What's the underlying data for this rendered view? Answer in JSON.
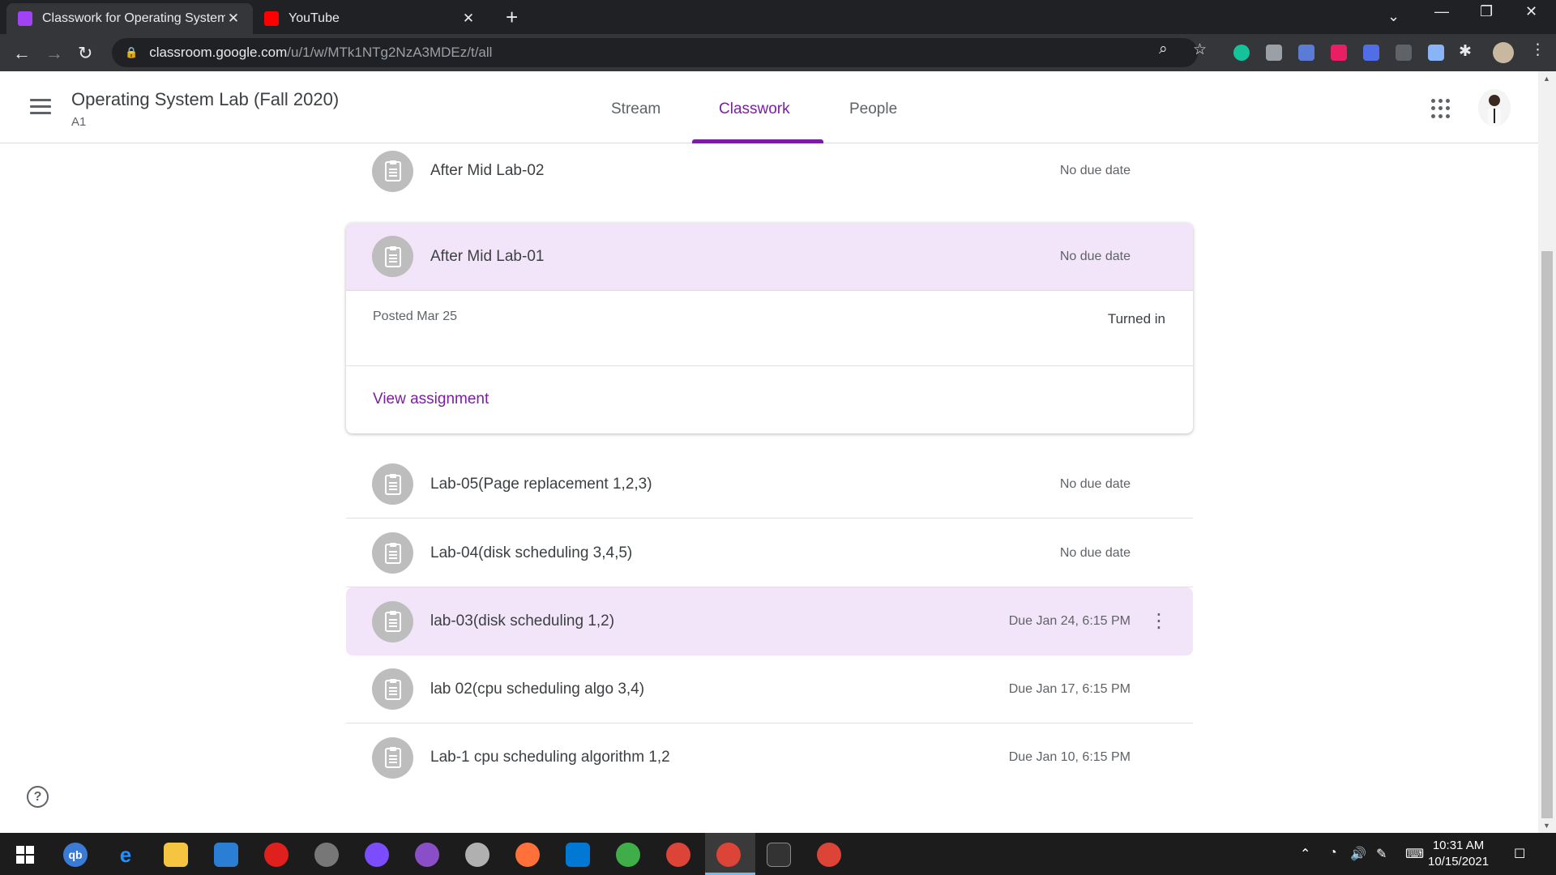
{
  "browser": {
    "tabs": [
      {
        "title": "Classwork for Operating System L",
        "active": true,
        "favicon_color": "#a142f4"
      },
      {
        "title": "YouTube",
        "active": false,
        "favicon_color": "#ff0000"
      }
    ],
    "url": {
      "host": "classroom.google.com",
      "path": "/u/1/w/MTk1NTg2NzA3MDEz/t/all"
    }
  },
  "header": {
    "course_title": "Operating System Lab (Fall 2020)",
    "course_section": "A1",
    "tabs": [
      {
        "label": "Stream",
        "active": false
      },
      {
        "label": "Classwork",
        "active": true
      },
      {
        "label": "People",
        "active": false
      }
    ]
  },
  "assignments": [
    {
      "name": "After Mid Lab-02",
      "due": "No due date"
    },
    {
      "name": "Lab-05(Page replacement 1,2,3)",
      "due": "No due date"
    },
    {
      "name": "Lab-04(disk scheduling 3,4,5)",
      "due": "No due date"
    },
    {
      "name": "lab-03(disk scheduling 1,2)",
      "due": "Due Jan 24, 6:15 PM"
    },
    {
      "name": "lab 02(cpu scheduling algo 3,4)",
      "due": "Due Jan 17, 6:15 PM"
    },
    {
      "name": "Lab-1 cpu scheduling algorithm 1,2",
      "due": "Due Jan 10, 6:15 PM"
    }
  ],
  "expanded": {
    "name": "After Mid Lab-01",
    "due": "No due date",
    "posted": "Posted Mar 25",
    "status": "Turned in",
    "link": "View assignment"
  },
  "help_label": "?",
  "taskbar": {
    "time": "10:31 AM",
    "date": "10/15/2021"
  },
  "colors": {
    "accent": "#7b1fa2",
    "highlight": "#f3e5f9"
  }
}
